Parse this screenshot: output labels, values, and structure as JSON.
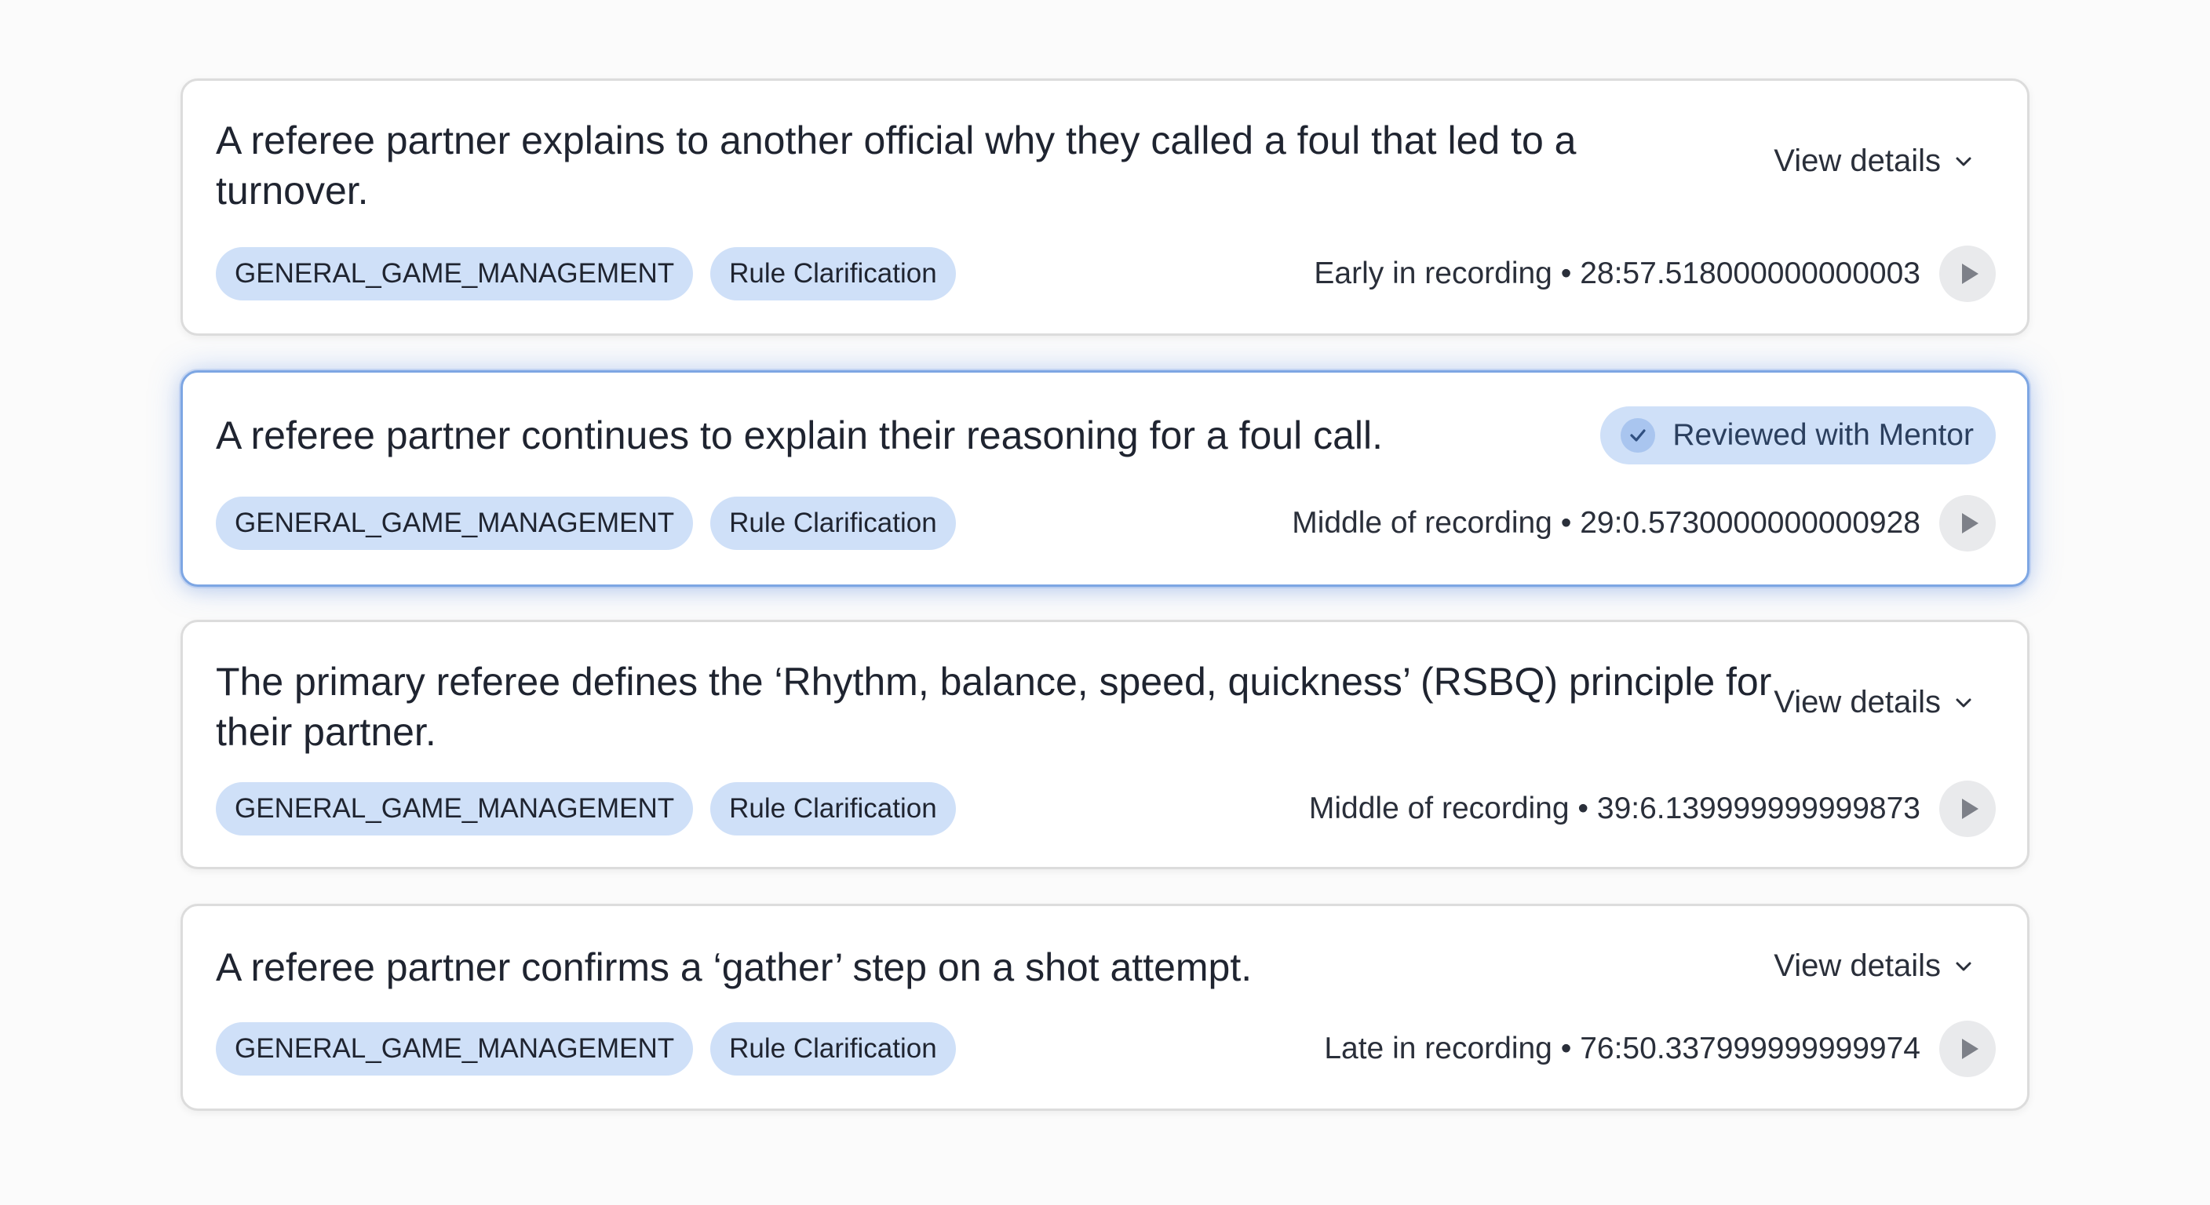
{
  "clips": [
    {
      "title": "A referee partner explains to another official why they called a foul that led to a turnover.",
      "tags": [
        "GENERAL_GAME_MANAGEMENT",
        "Rule Clarification"
      ],
      "position": "Early in recording",
      "separator": "•",
      "timestamp": "28:57.518000000000003",
      "action_label": "View details",
      "action_icon": "chevron-down-icon"
    },
    {
      "title": "A referee partner continues to explain their reasoning for a foul call.",
      "tags": [
        "GENERAL_GAME_MANAGEMENT",
        "Rule Clarification"
      ],
      "position": "Middle of recording",
      "separator": "•",
      "timestamp": "29:0.5730000000000928",
      "status_label": "Reviewed with Mentor",
      "status_icon": "check-icon"
    },
    {
      "title": "The primary referee defines the ‘Rhythm, balance, speed, quickness’ (RSBQ) principle for their partner.",
      "tags": [
        "GENERAL_GAME_MANAGEMENT",
        "Rule Clarification"
      ],
      "position": "Middle of recording",
      "separator": "•",
      "timestamp": "39:6.139999999999873",
      "action_label": "View details",
      "action_icon": "chevron-down-icon"
    },
    {
      "title": "A referee partner confirms a ‘gather’ step on a shot attempt.",
      "tags": [
        "GENERAL_GAME_MANAGEMENT",
        "Rule Clarification"
      ],
      "position": "Late in recording",
      "separator": "•",
      "timestamp": "76:50.337999999999974",
      "action_label": "View details",
      "action_icon": "chevron-down-icon"
    }
  ],
  "colors": {
    "tag_background": "#cfe0f8",
    "active_border": "#7da6e3",
    "card_border": "#dcdcdc",
    "page_background": "#fbfbfb"
  }
}
